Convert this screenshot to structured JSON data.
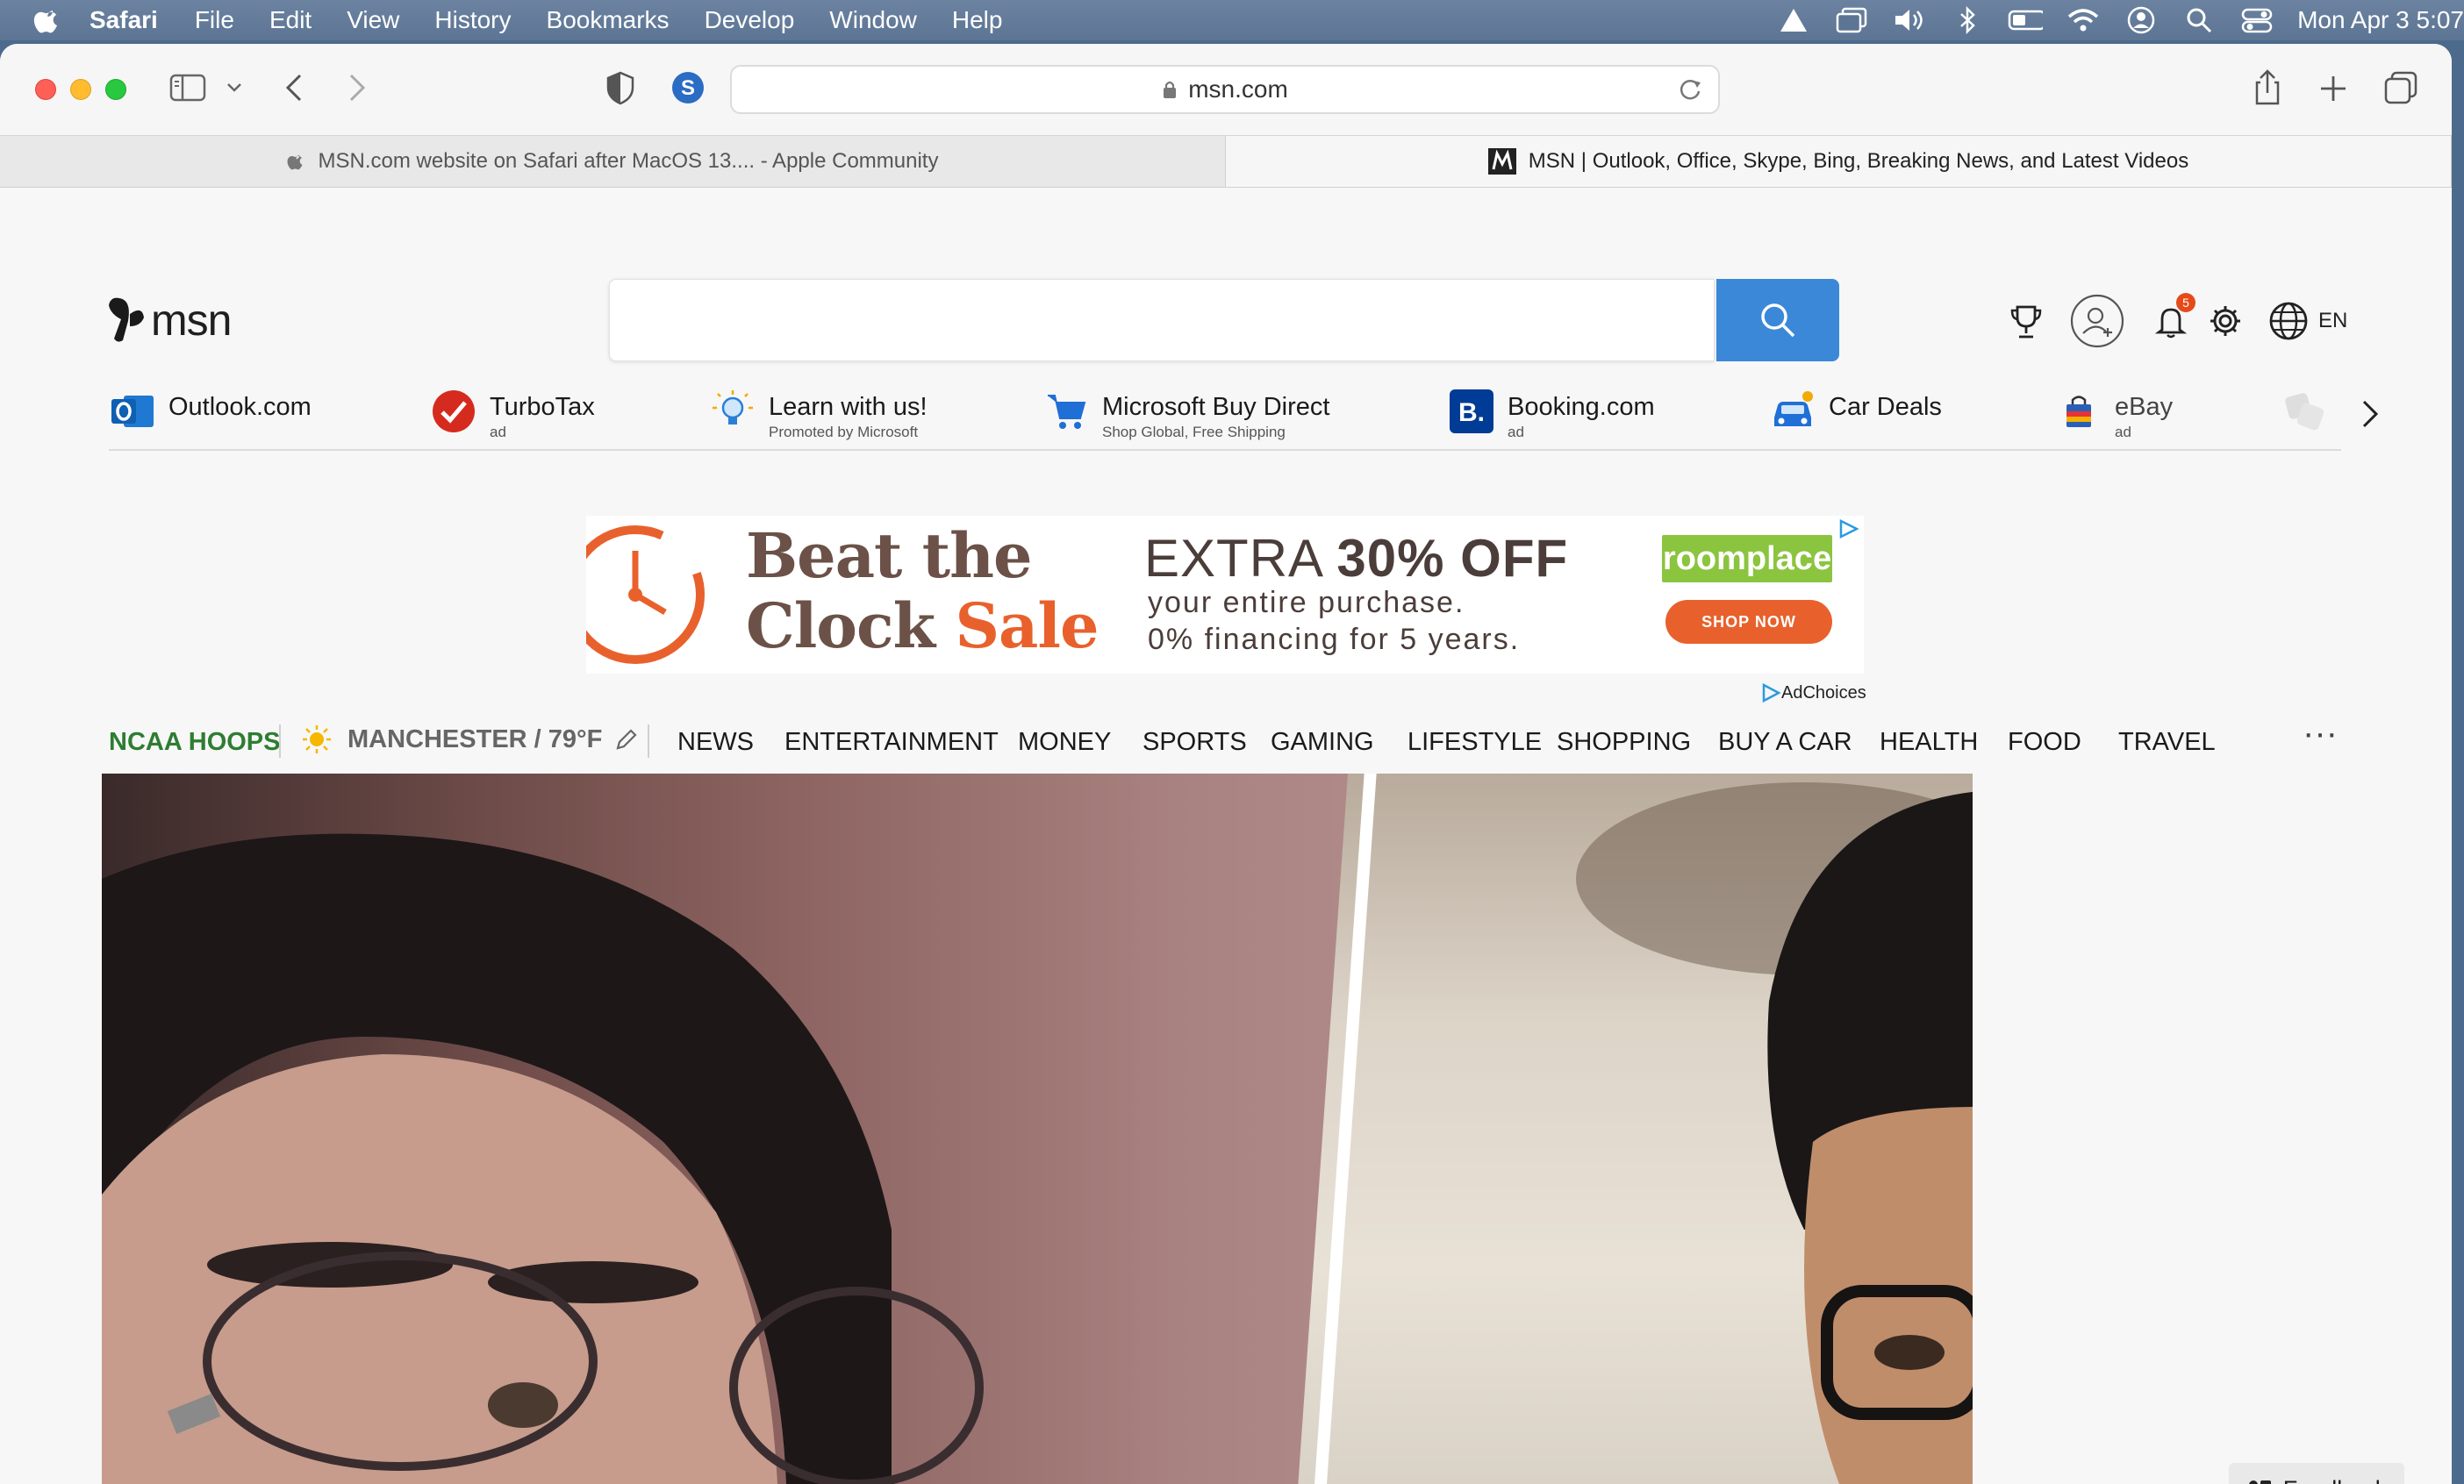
{
  "menubar": {
    "app_name": "Safari",
    "items": [
      "File",
      "Edit",
      "View",
      "History",
      "Bookmarks",
      "Develop",
      "Window",
      "Help"
    ],
    "clock": "Mon Apr 3  5:07"
  },
  "browser": {
    "address": "msn.com",
    "tabs": [
      {
        "title": "MSN.com website on Safari after MacOS 13.... - Apple Community"
      },
      {
        "title": "MSN | Outlook, Office, Skype, Bing, Breaking News, and Latest Videos"
      }
    ]
  },
  "header": {
    "logo_text": "msn",
    "search": {
      "value": "",
      "placeholder": ""
    },
    "notification_count": "5",
    "language": "EN"
  },
  "quicklinks": [
    {
      "label": "Outlook.com",
      "sub": ""
    },
    {
      "label": "TurboTax",
      "sub": "ad"
    },
    {
      "label": "Learn with us!",
      "sub": "Promoted by Microsoft"
    },
    {
      "label": "Microsoft Buy Direct",
      "sub": "Shop Global, Free Shipping"
    },
    {
      "label": "Booking.com",
      "sub": "ad"
    },
    {
      "label": "Car Deals",
      "sub": ""
    },
    {
      "label": "eBay",
      "sub": "ad"
    }
  ],
  "ad": {
    "title_line1": "Beat the",
    "title_line2_a": "Clock ",
    "title_line2_b": "Sale",
    "extra_a": "EXTRA ",
    "extra_b": "30% OFF",
    "line1": "your entire purchase.",
    "line2": "0% financing for 5 years.",
    "brand": "roomplace",
    "cta": "SHOP NOW",
    "adchoices": "AdChoices"
  },
  "nav": {
    "highlight": "NCAA HOOPS",
    "weather": "MANCHESTER / 79°F",
    "categories": [
      "NEWS",
      "ENTERTAINMENT",
      "MONEY",
      "SPORTS",
      "GAMING",
      "LIFESTYLE",
      "SHOPPING",
      "BUY A CAR",
      "HEALTH",
      "FOOD",
      "TRAVEL"
    ],
    "more": "···"
  },
  "feedback": {
    "label": "Feedback"
  },
  "colors": {
    "search_button": "#3b88d8",
    "ncaa_green": "#2e7d32",
    "ad_orange": "#e8612c",
    "brand_green": "#8bc43f"
  }
}
